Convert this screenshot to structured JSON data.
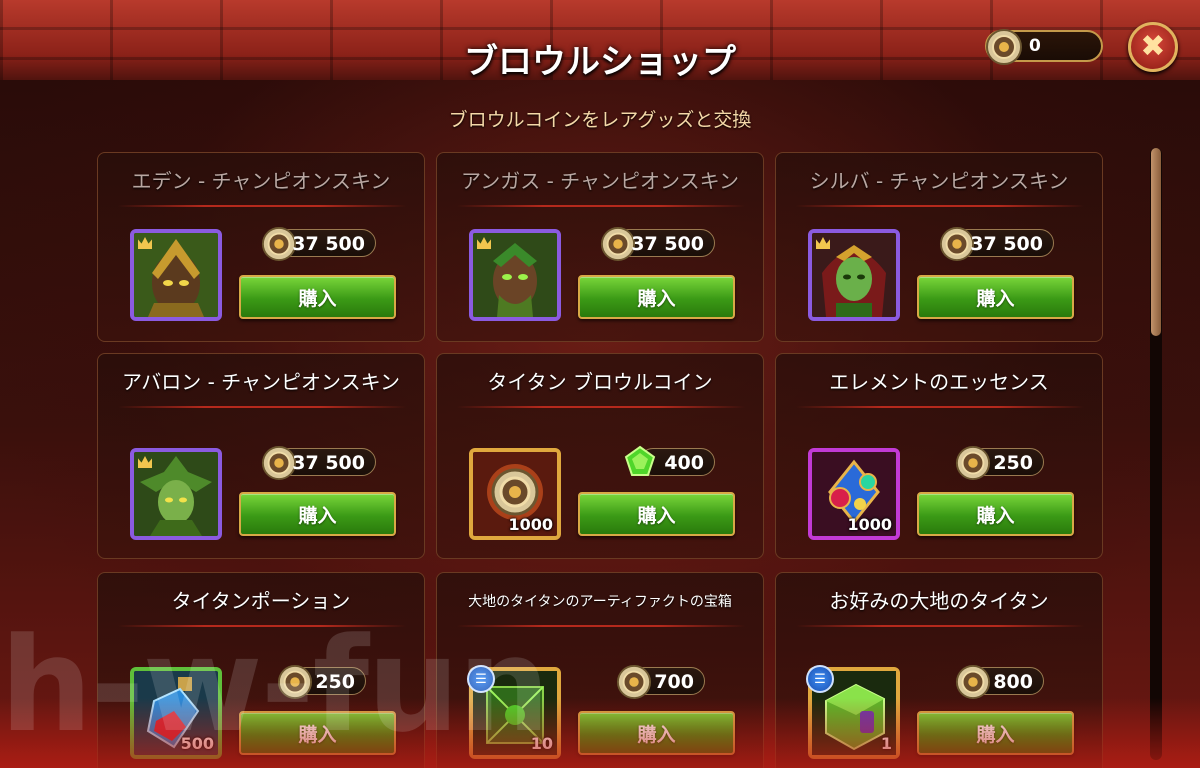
{
  "header": {
    "title": "ブロウルショップ",
    "subtitle": "ブロウルコインをレアグッズと交換",
    "currency_value": "0"
  },
  "colors": {
    "buy_button": "#3b9a16",
    "card_border": "#6a3a22",
    "divider": "#b5291c",
    "purple_frame": "#8b5be0",
    "gold_frame": "#e0a83e"
  },
  "buy_label": "購入",
  "watermark": "h-w-fun",
  "items": [
    {
      "title": "エデン - チャンピオンスキン",
      "price": "37 500",
      "currency": "brawl-coin",
      "icon": "eden-skin-icon",
      "frame": "purple"
    },
    {
      "title": "アンガス - チャンピオンスキン",
      "price": "37 500",
      "currency": "brawl-coin",
      "icon": "angus-skin-icon",
      "frame": "purple"
    },
    {
      "title": "シルバ - チャンピオンスキン",
      "price": "37 500",
      "currency": "brawl-coin",
      "icon": "sylva-skin-icon",
      "frame": "purple"
    },
    {
      "title": "アバロン - チャンピオンスキン",
      "price": "37 500",
      "currency": "brawl-coin",
      "icon": "avalon-skin-icon",
      "frame": "purple"
    },
    {
      "title": "タイタン ブロウルコイン",
      "price": "400",
      "currency": "emerald",
      "icon": "titan-brawl-coin-icon",
      "frame": "gold",
      "quantity": "1000"
    },
    {
      "title": "エレメントのエッセンス",
      "price": "250",
      "currency": "brawl-coin",
      "icon": "element-essence-icon",
      "frame": "purple",
      "quantity": "1000"
    },
    {
      "title": "タイタンポーション",
      "price": "250",
      "currency": "brawl-coin",
      "icon": "titan-potion-icon",
      "frame": "green",
      "quantity": "500"
    },
    {
      "title": "大地のタイタンのアーティファクトの宝箱",
      "price": "700",
      "currency": "brawl-coin",
      "icon": "earth-artifact-chest-icon",
      "frame": "gold",
      "quantity": "10"
    },
    {
      "title": "お好みの大地のタイタン",
      "price": "800",
      "currency": "brawl-coin",
      "icon": "earth-titan-choice-icon",
      "frame": "gold",
      "quantity": "1"
    }
  ]
}
